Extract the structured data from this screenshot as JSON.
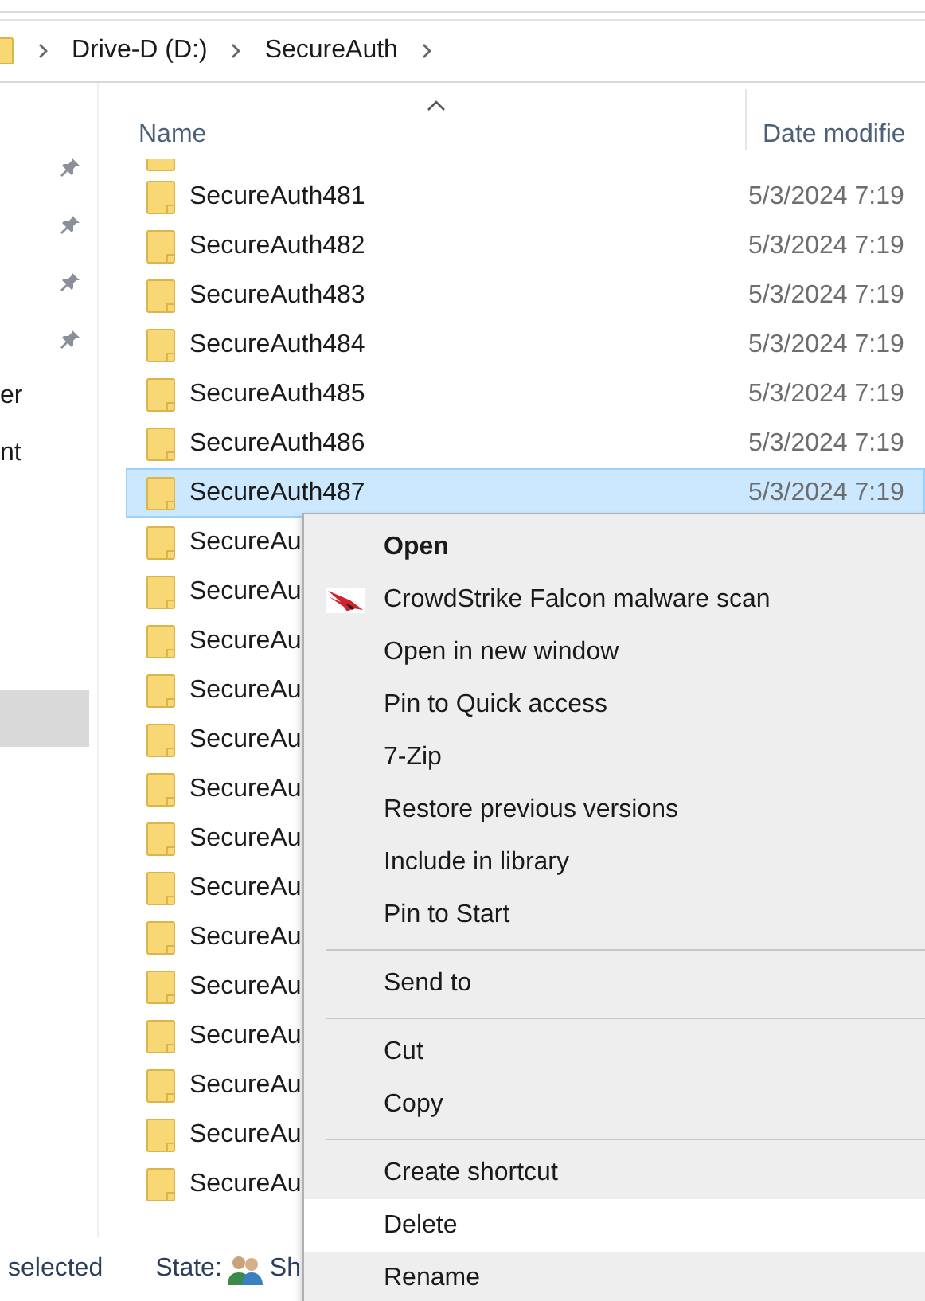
{
  "address_bar": {
    "crumbs": [
      "Drive-D (D:)",
      "SecureAuth"
    ]
  },
  "sidebar": {
    "items": [
      {
        "pinned": true,
        "selected": false
      },
      {
        "pinned": true,
        "selected": false
      },
      {
        "pinned": true,
        "selected": false
      },
      {
        "pinned": true,
        "selected": false
      },
      {
        "label": "er",
        "pinned": false,
        "selected": false
      },
      {
        "label": "nt",
        "pinned": false,
        "selected": false
      },
      {
        "pinned": false,
        "selected": true
      }
    ]
  },
  "table": {
    "columns": [
      "Name",
      "Date modifie"
    ],
    "rows": [
      {
        "name": "SecureAuth481",
        "date": "5/3/2024 7:19",
        "selected": false
      },
      {
        "name": "SecureAuth482",
        "date": "5/3/2024 7:19",
        "selected": false
      },
      {
        "name": "SecureAuth483",
        "date": "5/3/2024 7:19",
        "selected": false
      },
      {
        "name": "SecureAuth484",
        "date": "5/3/2024 7:19",
        "selected": false
      },
      {
        "name": "SecureAuth485",
        "date": "5/3/2024 7:19",
        "selected": false
      },
      {
        "name": "SecureAuth486",
        "date": "5/3/2024 7:19",
        "selected": false
      },
      {
        "name": "SecureAuth487",
        "date": "5/3/2024 7:19",
        "selected": true
      },
      {
        "name": "SecureAu",
        "selected": false
      },
      {
        "name": "SecureAu",
        "selected": false
      },
      {
        "name": "SecureAu",
        "selected": false
      },
      {
        "name": "SecureAu",
        "selected": false
      },
      {
        "name": "SecureAu",
        "selected": false
      },
      {
        "name": "SecureAu",
        "selected": false
      },
      {
        "name": "SecureAu",
        "selected": false
      },
      {
        "name": "SecureAu",
        "selected": false
      },
      {
        "name": "SecureAu",
        "selected": false
      },
      {
        "name": "SecureAu",
        "selected": false
      },
      {
        "name": "SecureAu",
        "selected": false
      },
      {
        "name": "SecureAu",
        "selected": false
      },
      {
        "name": "SecureAu",
        "selected": false
      },
      {
        "name": "SecureAu",
        "selected": false
      }
    ]
  },
  "context_menu": {
    "items": [
      {
        "kind": "item",
        "label": "Open",
        "default": true,
        "selected": false
      },
      {
        "kind": "scan",
        "label": "CrowdStrike Falcon malware scan",
        "default": false,
        "selected": false
      },
      {
        "kind": "item",
        "label": "Open in new window",
        "default": false,
        "selected": false
      },
      {
        "kind": "item",
        "label": "Pin to Quick access",
        "default": false,
        "selected": false
      },
      {
        "kind": "item",
        "label": "7-Zip",
        "default": false,
        "selected": false
      },
      {
        "kind": "item",
        "label": "Restore previous versions",
        "default": false,
        "selected": false
      },
      {
        "kind": "item",
        "label": "Include in library",
        "default": false,
        "selected": false
      },
      {
        "kind": "item",
        "label": "Pin to Start",
        "default": false,
        "selected": false
      },
      {
        "kind": "separator"
      },
      {
        "kind": "item",
        "label": "Send to",
        "default": false,
        "selected": false
      },
      {
        "kind": "separator"
      },
      {
        "kind": "item",
        "label": "Cut",
        "default": false,
        "selected": false
      },
      {
        "kind": "item",
        "label": "Copy",
        "default": false,
        "selected": false
      },
      {
        "kind": "separator"
      },
      {
        "kind": "item",
        "label": "Create shortcut",
        "default": false,
        "selected": false
      },
      {
        "kind": "item",
        "label": "Delete",
        "default": false,
        "selected": true
      },
      {
        "kind": "item",
        "label": "Rename",
        "default": false,
        "selected": false
      }
    ]
  },
  "status_bar": {
    "selection": "selected",
    "state_label": "State:",
    "state_value": "Sh"
  }
}
